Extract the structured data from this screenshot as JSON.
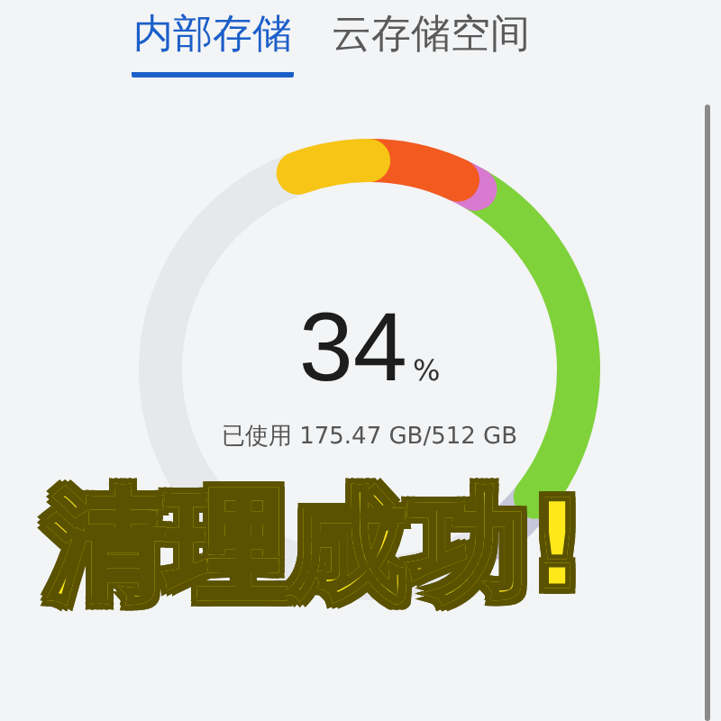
{
  "tabs": [
    {
      "label": "内部存储",
      "selected": true
    },
    {
      "label": "云存储空间",
      "selected": false
    }
  ],
  "storage": {
    "percent": "34",
    "unit": "%",
    "usage": "已使用 175.47 GB/512 GB"
  },
  "caption": "清理成功!"
}
